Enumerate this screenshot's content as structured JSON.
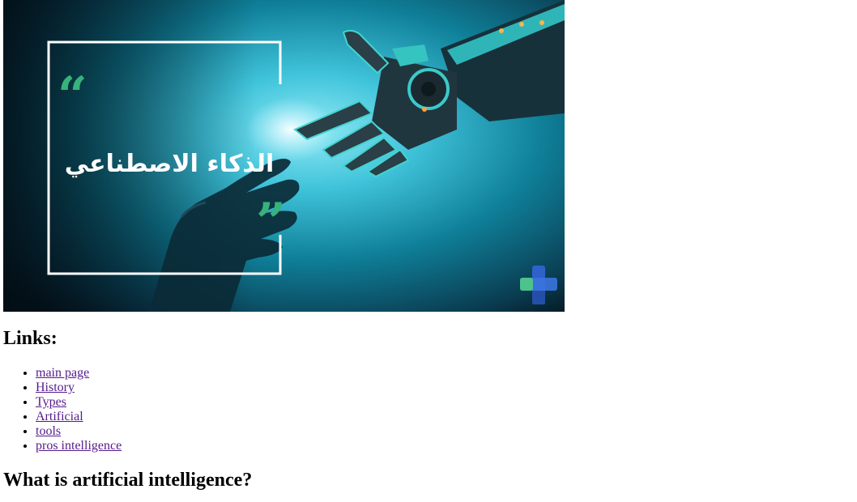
{
  "hero": {
    "title_text": "الذكاء الاصطناعي",
    "open_quote": "“",
    "close_quote": "”",
    "colors": {
      "bg_dark": "#061a24",
      "bg_mid": "#0d6f86",
      "bg_light": "#5fd2e8",
      "frame": "#ffffff",
      "quote_green": "#37b27a",
      "logo_green": "#4cc38a",
      "logo_blue": "#2f62c8"
    },
    "icons": [
      "human-hand-icon",
      "robot-hand-icon",
      "medical-cross-logo-icon"
    ]
  },
  "links": {
    "heading": "Links:",
    "items": [
      {
        "label": "main page"
      },
      {
        "label": "History"
      },
      {
        "label": "Types"
      },
      {
        "label": "Artificial"
      },
      {
        "label": "tools"
      },
      {
        "label": "pros intelligence"
      }
    ]
  },
  "main": {
    "section_heading": "What is artificial intelligence?"
  }
}
